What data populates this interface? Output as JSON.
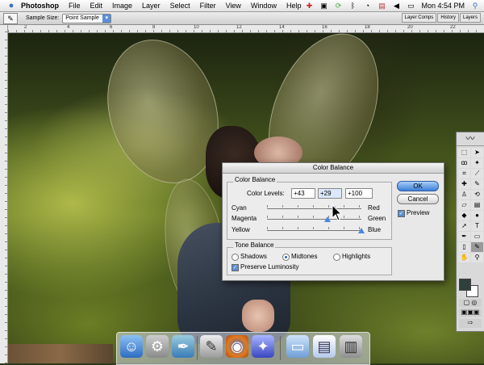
{
  "menubar": {
    "app": "Photoshop",
    "items": [
      "File",
      "Edit",
      "Image",
      "Layer",
      "Select",
      "Filter",
      "View",
      "Window",
      "Help"
    ],
    "clock": "Mon 4:54 PM"
  },
  "options": {
    "sample_size_label": "Sample Size:",
    "sample_size_value": "Point Sample",
    "palette_tabs": [
      "Layer Comps",
      "History",
      "Layers"
    ]
  },
  "rulers": {
    "top": [
      "2",
      "4",
      "6",
      "8",
      "10",
      "12",
      "14",
      "16",
      "18",
      "20",
      "22"
    ]
  },
  "dialog": {
    "title": "Color Balance",
    "group_title": "Color Balance",
    "levels_label": "Color Levels:",
    "levels": [
      "+43",
      "+29",
      "+100"
    ],
    "levels_fraction": [
      0.715,
      0.645,
      1.0
    ],
    "sliders": [
      {
        "left": "Cyan",
        "right": "Red"
      },
      {
        "left": "Magenta",
        "right": "Green"
      },
      {
        "left": "Yellow",
        "right": "Blue"
      }
    ],
    "tone_title": "Tone Balance",
    "tones": [
      "Shadows",
      "Midtones",
      "Highlights"
    ],
    "tone_selected": "Midtones",
    "preserve_luminosity": "Preserve Luminosity",
    "ok": "OK",
    "cancel": "Cancel",
    "preview": "Preview"
  },
  "colors": {
    "accent": "#3c7fd7",
    "foreground_swatch": "#2f3f3c",
    "background_swatch": "#ffffff"
  },
  "dock_icons": [
    "finder-icon",
    "system-preferences-icon",
    "mail-icon",
    "script-editor-icon",
    "firefox-icon",
    "ical-icon",
    "folder-icon",
    "documents-icon",
    "trash-icon"
  ]
}
